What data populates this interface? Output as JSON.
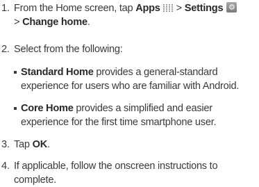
{
  "steps": [
    {
      "number": "1.",
      "line1_pre": "From the Home screen, tap ",
      "apps_label": "Apps",
      "sep1": "> ",
      "settings_label": "Settings",
      "sep2": "> ",
      "change_home_label": "Change home",
      "line_end": "."
    },
    {
      "number": "2.",
      "text": "Select from the following:"
    },
    {
      "number": "3.",
      "pre": "Tap ",
      "ok_label": "OK",
      "end": "."
    },
    {
      "number": "4.",
      "line1": "If applicable, follow the onscreen instructions to",
      "line2": "complete."
    }
  ],
  "options": [
    {
      "name": "Standard Home",
      "line1_rest": " provides a general-standard",
      "line2": "experience for users who are familiar with Android."
    },
    {
      "name": "Core Home",
      "line1_rest": " provides a simplified and easier",
      "line2": "experience for the first time smartphone user."
    }
  ],
  "icons": {
    "apps": "apps-grid-icon",
    "settings": "settings-icon"
  }
}
